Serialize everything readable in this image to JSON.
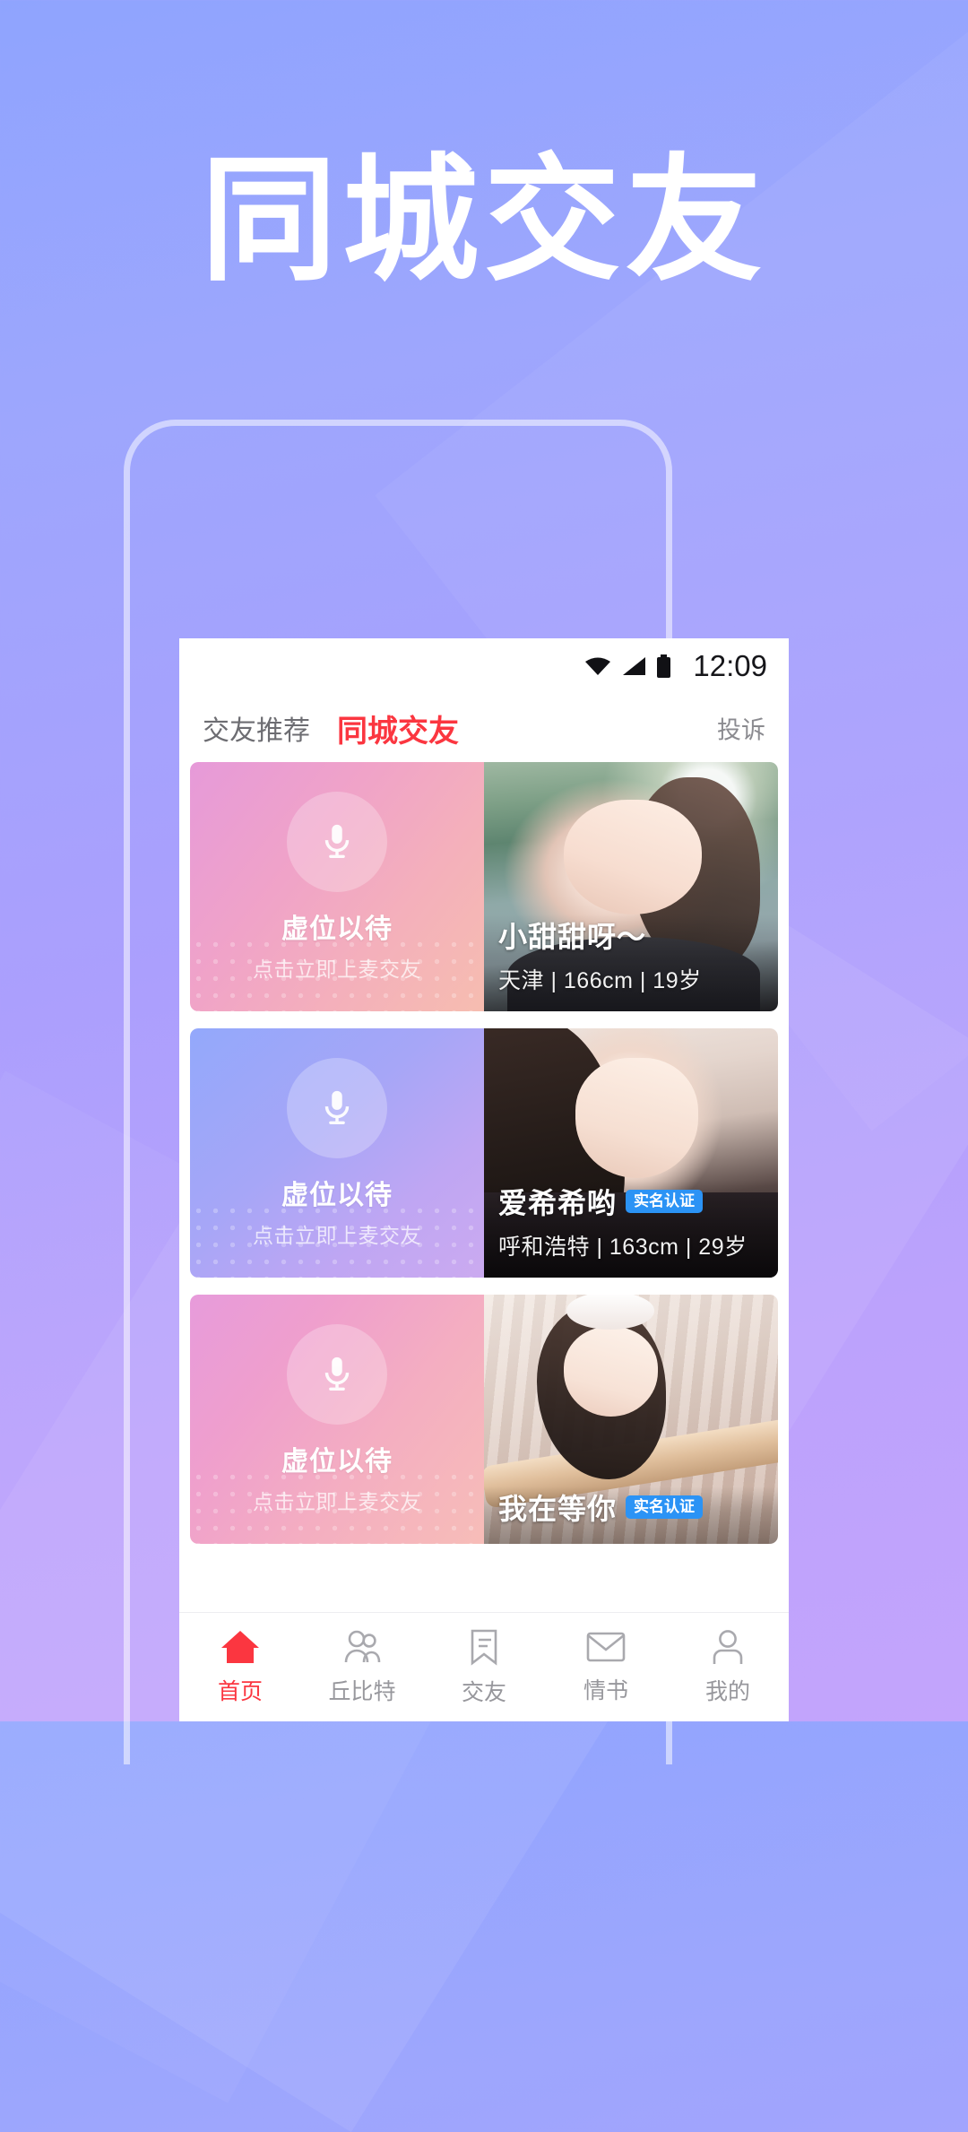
{
  "hero": {
    "title": "同城交友"
  },
  "theme": {
    "bg_top": "#8fa4fe",
    "bg_bottom": "#c3a4fc",
    "accent_red": "#fb3640",
    "badge_blue": "#2b93f5"
  },
  "statusbar": {
    "wifi_icon": "wifi-icon",
    "signal_icon": "signal-icon",
    "battery_icon": "battery-icon",
    "time": "12:09"
  },
  "header": {
    "tabs": [
      {
        "label": "交友推荐",
        "active": false
      },
      {
        "label": "同城交友",
        "active": true
      }
    ],
    "complain_label": "投诉"
  },
  "empty_slot": {
    "mic_icon": "microphone-icon",
    "title": "虚位以待",
    "subtitle": "点击立即上麦交友"
  },
  "cards": [
    {
      "slot_gradient": "g1",
      "photo": "p1",
      "name": "小甜甜呀～",
      "verified": false,
      "badge": "",
      "city": "天津",
      "height": "166cm",
      "age": "19岁",
      "meta": "天津 | 166cm | 19岁"
    },
    {
      "slot_gradient": "g2",
      "photo": "p2",
      "name": "爱希希哟",
      "verified": true,
      "badge": "实名认证",
      "city": "呼和浩特",
      "height": "163cm",
      "age": "29岁",
      "meta": "呼和浩特 | 163cm | 29岁"
    },
    {
      "slot_gradient": "g3",
      "photo": "p3",
      "name": "我在等你",
      "verified": true,
      "badge": "实名认证",
      "city": "",
      "height": "",
      "age": "",
      "meta": ""
    }
  ],
  "bottomnav": {
    "items": [
      {
        "label": "首页",
        "icon": "home-icon",
        "active": true
      },
      {
        "label": "丘比特",
        "icon": "two-people-icon",
        "active": false
      },
      {
        "label": "交友",
        "icon": "chat-bookmark-icon",
        "active": false
      },
      {
        "label": "情书",
        "icon": "envelope-icon",
        "active": false
      },
      {
        "label": "我的",
        "icon": "person-icon",
        "active": false
      }
    ]
  }
}
